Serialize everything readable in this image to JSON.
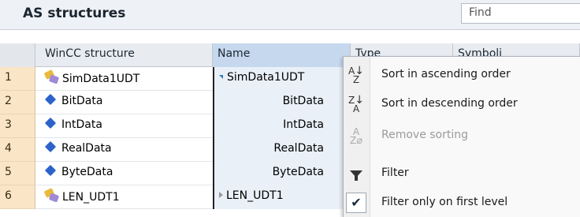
{
  "panel": {
    "title": "AS structures",
    "find_placeholder": "Find"
  },
  "columns": {
    "wincc": "WinCC structure",
    "name": "Name",
    "type": "Type",
    "symbolic": "Symboli"
  },
  "rows": [
    {
      "num": "1",
      "wincc": "SimData1UDT",
      "name": "SimData1UDT",
      "kind": "udt",
      "name_style": "expanded"
    },
    {
      "num": "2",
      "wincc": "BitData",
      "name": "BitData",
      "kind": "data",
      "name_style": "child"
    },
    {
      "num": "3",
      "wincc": "IntData",
      "name": "IntData",
      "kind": "data",
      "name_style": "child"
    },
    {
      "num": "4",
      "wincc": "RealData",
      "name": "RealData",
      "kind": "data",
      "name_style": "child"
    },
    {
      "num": "5",
      "wincc": "ByteData",
      "name": "ByteData",
      "kind": "data",
      "name_style": "child"
    },
    {
      "num": "6",
      "wincc": "LEN_UDT1",
      "name": "LEN_UDT1",
      "kind": "udt",
      "name_style": "collapsed"
    }
  ],
  "context_menu": {
    "sort_ascending": "Sort in ascending order",
    "sort_descending": "Sort in descending order",
    "remove_sorting": "Remove sorting",
    "filter": "Filter",
    "filter_first_level": "Filter only on first level",
    "filter_first_level_checked": true
  },
  "colors": {
    "row_number_bg": "#fae5c6",
    "name_column_header": "#c6d8ee",
    "data_icon": "#2c62c9",
    "udt_icon_yellow": "#e8b93b",
    "udt_icon_purple": "#9e8ad6"
  },
  "icons": {
    "udt": "structure-icon",
    "data": "data-element-icon",
    "sort_ascending": "sort-az-icon",
    "sort_descending": "sort-za-icon",
    "remove_sorting": "remove-sort-icon",
    "filter": "filter-funnel-icon",
    "filter_first_level": "checkmark-icon"
  }
}
